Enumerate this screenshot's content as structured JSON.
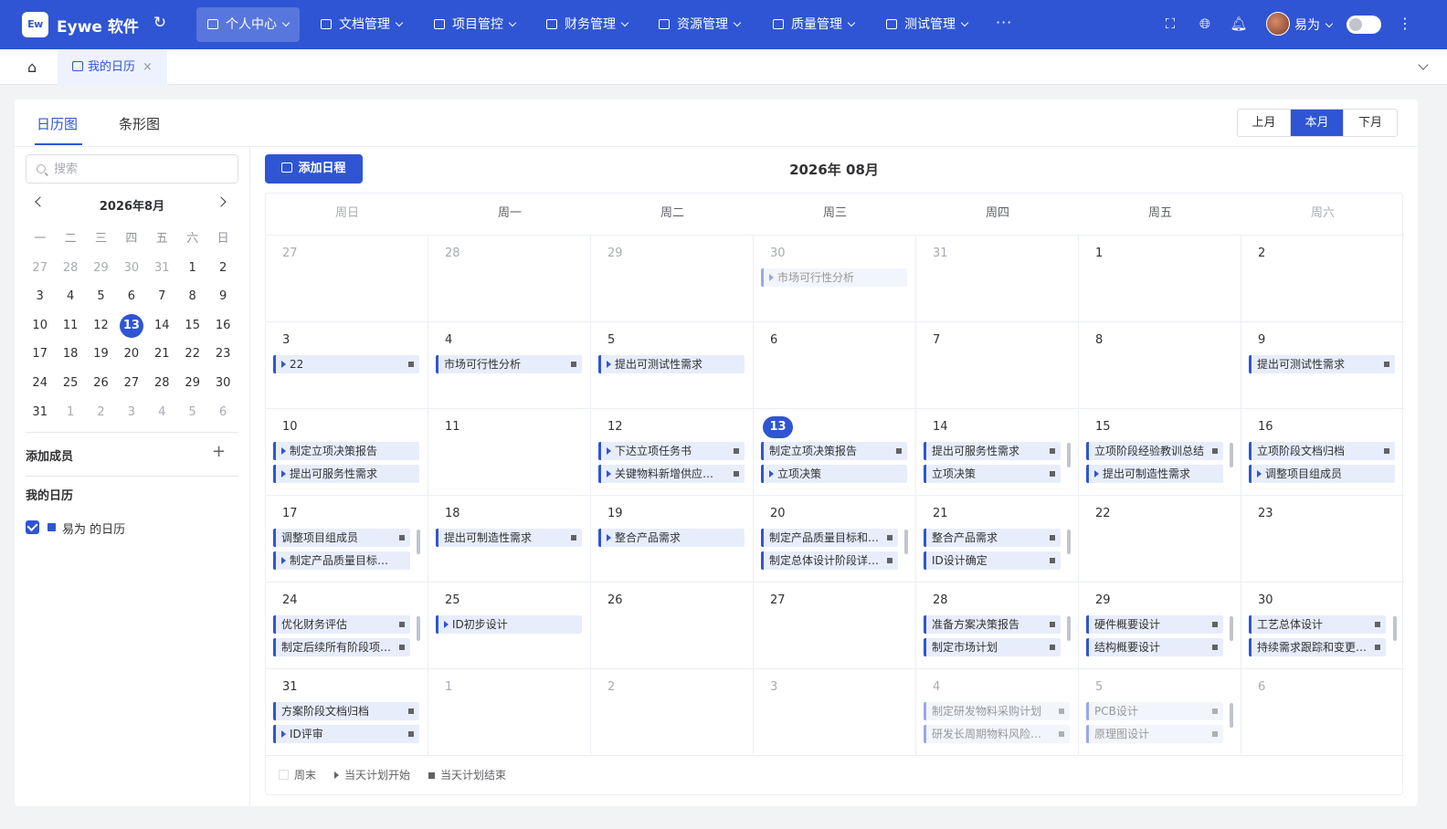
{
  "app": {
    "logo_text": "Ew",
    "name": "Eywe 软件"
  },
  "nav": [
    {
      "label": "个人中心",
      "icon": "home-icon",
      "active": true
    },
    {
      "label": "文档管理",
      "icon": "folder-icon"
    },
    {
      "label": "项目管控",
      "icon": "project-icon"
    },
    {
      "label": "财务管理",
      "icon": "finance-icon"
    },
    {
      "label": "资源管理",
      "icon": "resource-icon"
    },
    {
      "label": "质量管理",
      "icon": "shield-icon"
    },
    {
      "label": "测试管理",
      "icon": "test-icon"
    }
  ],
  "topbar": {
    "more": "···",
    "user_name": "易为"
  },
  "tabs": {
    "open_tab": "我的日历",
    "close": "×"
  },
  "view_tabs": {
    "calendar": "日历图",
    "bar": "条形图"
  },
  "month_buttons": {
    "prev": "上月",
    "current": "本月",
    "next": "下月"
  },
  "search": {
    "placeholder": "搜索",
    "value": ""
  },
  "mini_calendar": {
    "title": "2026年8月",
    "weekdays": [
      "一",
      "二",
      "三",
      "四",
      "五",
      "六",
      "日"
    ],
    "weeks": [
      [
        {
          "d": "27",
          "o": true
        },
        {
          "d": "28",
          "o": true
        },
        {
          "d": "29",
          "o": true
        },
        {
          "d": "30",
          "o": true
        },
        {
          "d": "31",
          "o": true
        },
        {
          "d": "1"
        },
        {
          "d": "2"
        }
      ],
      [
        {
          "d": "3"
        },
        {
          "d": "4"
        },
        {
          "d": "5"
        },
        {
          "d": "6"
        },
        {
          "d": "7"
        },
        {
          "d": "8"
        },
        {
          "d": "9"
        }
      ],
      [
        {
          "d": "10"
        },
        {
          "d": "11"
        },
        {
          "d": "12"
        },
        {
          "d": "13",
          "today": true
        },
        {
          "d": "14"
        },
        {
          "d": "15"
        },
        {
          "d": "16"
        }
      ],
      [
        {
          "d": "17"
        },
        {
          "d": "18"
        },
        {
          "d": "19"
        },
        {
          "d": "20"
        },
        {
          "d": "21"
        },
        {
          "d": "22"
        },
        {
          "d": "23"
        }
      ],
      [
        {
          "d": "24"
        },
        {
          "d": "25"
        },
        {
          "d": "26"
        },
        {
          "d": "27"
        },
        {
          "d": "28"
        },
        {
          "d": "29"
        },
        {
          "d": "30"
        }
      ],
      [
        {
          "d": "31"
        },
        {
          "d": "1",
          "o": true
        },
        {
          "d": "2",
          "o": true
        },
        {
          "d": "3",
          "o": true
        },
        {
          "d": "4",
          "o": true
        },
        {
          "d": "5",
          "o": true
        },
        {
          "d": "6",
          "o": true
        }
      ]
    ]
  },
  "sidebar": {
    "add_member": "添加成员",
    "add_icon": "+",
    "my_calendar": "我的日历",
    "calendar_item": "易为 的日历",
    "calendar_checked": true,
    "calendar_color": "#2f55d4"
  },
  "main": {
    "add_button": "添加日程",
    "title": "2026年 08月"
  },
  "calendar": {
    "weekdays": [
      {
        "label": "周日",
        "weekend": true
      },
      {
        "label": "周一"
      },
      {
        "label": "周二"
      },
      {
        "label": "周三"
      },
      {
        "label": "周四"
      },
      {
        "label": "周五"
      },
      {
        "label": "周六",
        "weekend": true
      }
    ],
    "weeks": [
      [
        {
          "day": "27",
          "other": true,
          "events": []
        },
        {
          "day": "28",
          "other": true,
          "events": []
        },
        {
          "day": "29",
          "other": true,
          "events": []
        },
        {
          "day": "30",
          "other": true,
          "events": [
            {
              "title": "市场可行性分析",
              "start": true,
              "end": false,
              "faded": true
            }
          ]
        },
        {
          "day": "31",
          "other": true,
          "events": []
        },
        {
          "day": "1",
          "events": []
        },
        {
          "day": "2",
          "events": []
        }
      ],
      [
        {
          "day": "3",
          "events": [
            {
              "title": "22",
              "start": true,
              "end": true
            }
          ]
        },
        {
          "day": "4",
          "events": [
            {
              "title": "市场可行性分析",
              "start": false,
              "end": true
            }
          ]
        },
        {
          "day": "5",
          "events": [
            {
              "title": "提出可测试性需求",
              "start": true,
              "end": false
            }
          ]
        },
        {
          "day": "6",
          "events": []
        },
        {
          "day": "7",
          "events": []
        },
        {
          "day": "8",
          "events": []
        },
        {
          "day": "9",
          "events": [
            {
              "title": "提出可测试性需求",
              "start": false,
              "end": true
            }
          ]
        }
      ],
      [
        {
          "day": "10",
          "events": [
            {
              "title": "制定立项决策报告",
              "start": true,
              "end": false
            },
            {
              "title": "提出可服务性需求",
              "start": true,
              "end": false
            }
          ]
        },
        {
          "day": "11",
          "events": []
        },
        {
          "day": "12",
          "events": [
            {
              "title": "下达立项任务书",
              "start": true,
              "end": true
            },
            {
              "title": "关键物料新增供应商…",
              "start": true,
              "end": true
            }
          ]
        },
        {
          "day": "13",
          "today": true,
          "events": [
            {
              "title": "制定立项决策报告",
              "start": false,
              "end": true
            },
            {
              "title": "立项决策",
              "start": true,
              "end": false
            }
          ]
        },
        {
          "day": "14",
          "scroll": true,
          "events": [
            {
              "title": "提出可服务性需求",
              "start": false,
              "end": true
            },
            {
              "title": "立项决策",
              "start": false,
              "end": true
            }
          ]
        },
        {
          "day": "15",
          "scroll": true,
          "events": [
            {
              "title": "立项阶段经验教训总结",
              "start": false,
              "end": true
            },
            {
              "title": "提出可制造性需求",
              "start": true,
              "end": false
            }
          ]
        },
        {
          "day": "16",
          "events": [
            {
              "title": "立项阶段文档归档",
              "start": false,
              "end": true
            },
            {
              "title": "调整项目组成员",
              "start": true,
              "end": false
            }
          ]
        }
      ],
      [
        {
          "day": "17",
          "scroll": true,
          "events": [
            {
              "title": "调整项目组成员",
              "start": false,
              "end": true
            },
            {
              "title": "制定产品质量目标和…",
              "start": true,
              "end": false
            }
          ]
        },
        {
          "day": "18",
          "events": [
            {
              "title": "提出可制造性需求",
              "start": false,
              "end": true
            }
          ]
        },
        {
          "day": "19",
          "events": [
            {
              "title": "整合产品需求",
              "start": true,
              "end": false
            }
          ]
        },
        {
          "day": "20",
          "scroll": true,
          "events": [
            {
              "title": "制定产品质量目标和…",
              "start": false,
              "end": true
            },
            {
              "title": "制定总体设计阶段详…",
              "start": false,
              "end": true
            }
          ]
        },
        {
          "day": "21",
          "scroll": true,
          "events": [
            {
              "title": "整合产品需求",
              "start": false,
              "end": true
            },
            {
              "title": "ID设计确定",
              "start": false,
              "end": true
            }
          ]
        },
        {
          "day": "22",
          "events": []
        },
        {
          "day": "23",
          "events": []
        }
      ],
      [
        {
          "day": "24",
          "scroll": true,
          "events": [
            {
              "title": "优化财务评估",
              "start": false,
              "end": true
            },
            {
              "title": "制定后续所有阶段项…",
              "start": false,
              "end": true
            }
          ]
        },
        {
          "day": "25",
          "events": [
            {
              "title": "ID初步设计",
              "start": true,
              "end": false
            }
          ]
        },
        {
          "day": "26",
          "events": []
        },
        {
          "day": "27",
          "events": []
        },
        {
          "day": "28",
          "scroll": true,
          "events": [
            {
              "title": "准备方案决策报告",
              "start": false,
              "end": true
            },
            {
              "title": "制定市场计划",
              "start": false,
              "end": true
            }
          ]
        },
        {
          "day": "29",
          "scroll": true,
          "events": [
            {
              "title": "硬件概要设计",
              "start": false,
              "end": true
            },
            {
              "title": "结构概要设计",
              "start": false,
              "end": true
            }
          ]
        },
        {
          "day": "30",
          "scroll": true,
          "events": [
            {
              "title": "工艺总体设计",
              "start": false,
              "end": true
            },
            {
              "title": "持续需求跟踪和变更…",
              "start": false,
              "end": true
            }
          ]
        }
      ],
      [
        {
          "day": "31",
          "events": [
            {
              "title": "方案阶段文档归档",
              "start": false,
              "end": true
            },
            {
              "title": "ID评审",
              "start": true,
              "end": true
            }
          ]
        },
        {
          "day": "1",
          "other": true,
          "events": []
        },
        {
          "day": "2",
          "other": true,
          "events": []
        },
        {
          "day": "3",
          "other": true,
          "events": []
        },
        {
          "day": "4",
          "other": true,
          "events": [
            {
              "title": "制定研发物料采购计划",
              "start": false,
              "end": true,
              "faded": true
            },
            {
              "title": "研发长周期物料风险采购",
              "start": false,
              "end": true,
              "faded": true
            }
          ]
        },
        {
          "day": "5",
          "other": true,
          "scroll": true,
          "events": [
            {
              "title": "PCB设计",
              "start": false,
              "end": true,
              "faded": true
            },
            {
              "title": "原理图设计",
              "start": false,
              "end": true,
              "faded": true
            }
          ]
        },
        {
          "day": "6",
          "other": true,
          "events": []
        }
      ]
    ]
  },
  "legend": {
    "weekend": "周末",
    "plan_start": "当天计划开始",
    "plan_end": "当天计划结束"
  },
  "colors": {
    "primary": "#2f55d4",
    "event_bg": "#e8edfc"
  }
}
